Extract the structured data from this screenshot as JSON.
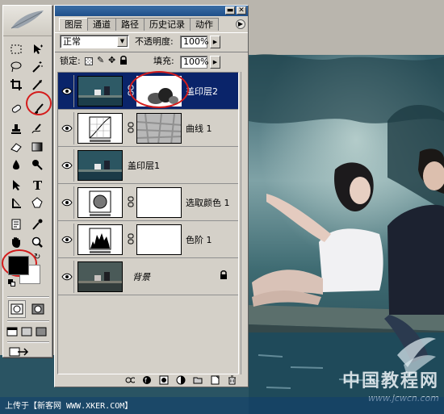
{
  "tabs": [
    {
      "label": "图层",
      "active": true
    },
    {
      "label": "通道",
      "active": false
    },
    {
      "label": "路径",
      "active": false
    },
    {
      "label": "历史记录",
      "active": false
    },
    {
      "label": "动作",
      "active": false
    }
  ],
  "blend_mode": {
    "value": "正常"
  },
  "opacity": {
    "label": "不透明度:",
    "value": "100%"
  },
  "lock": {
    "label": "锁定:"
  },
  "fill": {
    "label": "填充:",
    "value": "100%"
  },
  "layers": [
    {
      "name": "盖印层2",
      "selected": true,
      "has_mask": true,
      "lock": false
    },
    {
      "name": "曲线 1",
      "selected": false,
      "has_mask": true,
      "lock": false
    },
    {
      "name": "盖印层1",
      "selected": false,
      "has_mask": false,
      "lock": false
    },
    {
      "name": "选取颜色 1",
      "selected": false,
      "has_mask": true,
      "lock": false
    },
    {
      "name": "色阶 1",
      "selected": false,
      "has_mask": true,
      "lock": false
    },
    {
      "name": "背景",
      "selected": false,
      "has_mask": false,
      "lock": true
    }
  ],
  "credit": "上传于【新客网 WWW.XKER.COM】",
  "watermark": {
    "text": "中国教程网",
    "url": "www.jcwcn.com"
  },
  "colors": {
    "foreground": "#000000",
    "background": "#ffffff",
    "selection": "#0a246a",
    "annotation": "#d41c1c"
  }
}
